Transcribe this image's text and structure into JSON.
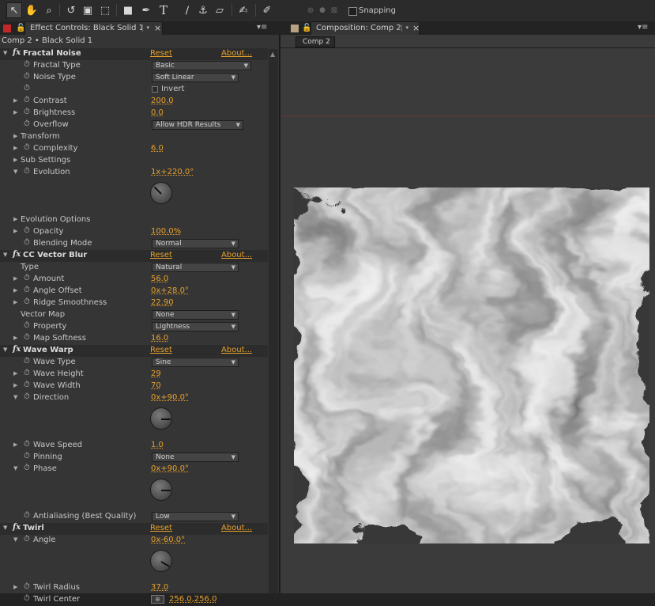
{
  "toolbar": {
    "tool_icons": [
      "selection-tool",
      "hand-tool",
      "zoom-tool",
      "rotation-tool",
      "orbit-camera-tool",
      "pan-behind-tool",
      "rectangle-tool",
      "pen-tool",
      "type-tool",
      "brush-tool",
      "clone-stamp-tool",
      "eraser-tool",
      "roto-brush-tool",
      "puppet-pin-tool"
    ],
    "snapping_label": "Snapping"
  },
  "left_tab": {
    "label": "Effect Controls: Black Solid 1"
  },
  "right_tab": {
    "label": "Composition: Comp 2"
  },
  "breadcrumb": "Comp 2 • Black Solid 1",
  "comp_button": "Comp 2",
  "reset_label": "Reset",
  "about_label": "About...",
  "invert_label": "Invert",
  "rows": [
    {
      "kind": "effect",
      "label": "Fractal Noise"
    },
    {
      "kind": "prop",
      "label": "Fractal Type",
      "dropdown": "Basic",
      "dd_w": 126
    },
    {
      "kind": "prop",
      "label": "Noise Type",
      "dropdown": "Soft Linear",
      "dd_w": 110
    },
    {
      "kind": "check",
      "label": ""
    },
    {
      "kind": "prop",
      "twirl": true,
      "label": "Contrast",
      "value": "200.0"
    },
    {
      "kind": "prop",
      "twirl": true,
      "label": "Brightness",
      "value": "0.0"
    },
    {
      "kind": "prop",
      "label": "Overflow",
      "dropdown": "Allow HDR Results",
      "dd_w": 116
    },
    {
      "kind": "group",
      "label": "Transform"
    },
    {
      "kind": "prop",
      "twirl": true,
      "label": "Complexity",
      "value": "6.0"
    },
    {
      "kind": "group",
      "label": "Sub Settings"
    },
    {
      "kind": "prop",
      "twirl": true,
      "open": true,
      "label": "Evolution",
      "value": "1x+220.0°"
    },
    {
      "kind": "dial",
      "angle": -135
    },
    {
      "kind": "group",
      "label": "Evolution Options"
    },
    {
      "kind": "prop",
      "twirl": true,
      "label": "Opacity",
      "value": "100.0%"
    },
    {
      "kind": "prop",
      "label": "Blending Mode",
      "dropdown": "Normal",
      "dd_w": 110
    },
    {
      "kind": "effect",
      "label": "CC Vector Blur"
    },
    {
      "kind": "prop",
      "nostop": true,
      "label": "Type",
      "dropdown": "Natural",
      "dd_w": 110
    },
    {
      "kind": "prop",
      "twirl": true,
      "label": "Amount",
      "value": "56.0"
    },
    {
      "kind": "prop",
      "twirl": true,
      "label": "Angle Offset",
      "value": "0x+28.0°"
    },
    {
      "kind": "prop",
      "twirl": true,
      "label": "Ridge Smoothness",
      "value": "22.90"
    },
    {
      "kind": "prop",
      "nostop": true,
      "label": "Vector Map",
      "dropdown": "None",
      "dd_w": 110
    },
    {
      "kind": "prop",
      "label": "Property",
      "dropdown": "Lightness",
      "dd_w": 110
    },
    {
      "kind": "prop",
      "twirl": true,
      "label": "Map Softness",
      "value": "16.0"
    },
    {
      "kind": "effect",
      "label": "Wave Warp"
    },
    {
      "kind": "prop",
      "label": "Wave Type",
      "dropdown": "Sine",
      "dd_w": 110
    },
    {
      "kind": "prop",
      "twirl": true,
      "label": "Wave Height",
      "value": "29"
    },
    {
      "kind": "prop",
      "twirl": true,
      "label": "Wave Width",
      "value": "70"
    },
    {
      "kind": "prop",
      "twirl": true,
      "open": true,
      "label": "Direction",
      "value": "0x+90.0°"
    },
    {
      "kind": "dial",
      "angle": 0
    },
    {
      "kind": "prop",
      "twirl": true,
      "label": "Wave Speed",
      "value": "1.0"
    },
    {
      "kind": "prop",
      "label": "Pinning",
      "dropdown": "None",
      "dd_w": 110
    },
    {
      "kind": "prop",
      "twirl": true,
      "open": true,
      "label": "Phase",
      "value": "0x+90.0°"
    },
    {
      "kind": "dial",
      "angle": 0
    },
    {
      "kind": "prop",
      "label": "Antialiasing (Best Quality)",
      "dropdown": "Low",
      "dd_w": 110
    },
    {
      "kind": "effect",
      "label": "Twirl"
    },
    {
      "kind": "prop",
      "twirl": true,
      "open": true,
      "label": "Angle",
      "value": "0x-60.0°"
    },
    {
      "kind": "dial",
      "angle": 30
    },
    {
      "kind": "prop",
      "twirl": true,
      "label": "Twirl Radius",
      "value": "37.0"
    },
    {
      "kind": "point",
      "label": "Twirl Center",
      "value": "256.0,256.0"
    }
  ]
}
